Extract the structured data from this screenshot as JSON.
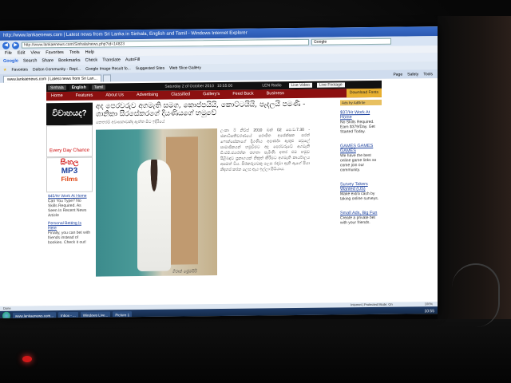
{
  "browser": {
    "title": "http://www.lankaenews.com | Latest news from Sri Lanka in Sinhala, English and Tamil - Windows Internet Explorer",
    "url": "http://www.lankaenews.com/Sinhala/news.php?id=14823",
    "search_engine": "Google",
    "menu": [
      "File",
      "Edit",
      "View",
      "Favorites",
      "Tools",
      "Help"
    ],
    "toolbar": [
      "Google",
      "Search",
      "Share",
      "Bookmarks",
      "Check",
      "Translate",
      "AutoFill"
    ],
    "favorites": [
      "Favorites",
      "Dalton Community - Repl...",
      "Google Image Result fo...",
      "Suggested Sites",
      "Web Slice Gallery"
    ],
    "tab_label": "www.lankaenews.com | Latest news from Sri Lan...",
    "commands": [
      "Page",
      "Safety",
      "Tools"
    ]
  },
  "site": {
    "languages": [
      "Sinhala",
      "English",
      "Tamil"
    ],
    "date": "Saturday 2 of October 2010",
    "time": "10:55:00",
    "top_links": [
      "LEN Radio",
      "Live Video",
      "Live Footage"
    ],
    "nav": [
      "Home",
      "Features",
      "About Us",
      "Advertising",
      "Classified",
      "Gallery's",
      "Feed Back",
      "Business"
    ],
    "download_label": "Download Fonts"
  },
  "left_ads": {
    "black_ad": "විවාහයද?",
    "cartoon_ad": "Every Day Chance",
    "films": [
      "සිංහල",
      "MP3",
      "Films"
    ],
    "text_ads": [
      {
        "title": "$45/Hr Work At Home",
        "body": "Can You Type? No Skills Required. As Seen In Recent News Article"
      },
      {
        "title": "Personal Betting Is Here",
        "body": "Finally, you can bet with friends instead of bookies. Check it out!"
      }
    ]
  },
  "article": {
    "headline": "අද පෙරවරුව අගමැති සමග, කොප්පයියි, කොට්ටයියි, පැදලයි පමණි - ශානිකා සීරසේකරගේ දියණියගේ හමුවේ",
    "subhead": "කෙතරම් අවාසනාවක්ද ඇත්ත මිට ඉදිරියේ",
    "caption": "ශිරාන් ප්‍රේමසිරි",
    "body": "ලංකා ඊ නිව්ස් 2010 ඔක් 02 පෙ.ව.7.30 - ජනාධිපතිවරණයේ පරාජිත අපේක්ෂක සරත් ෆොන්සේකාගේ දියණිය අපර්ණා ඇතුළු පවුලේ සාමාජිකයන් හමුවීමට අද පෙරවරුවේ අගමැති ඩී.එම්.ජයරත්න මහතා පැමිණි අතර එම හමුව පිළිබඳව ප්‍රකාශයක් නිකුත් කිරීමට අගමැති කාර්යාලය අසමත් විය. සිරකරුවෙකු ලෙස රඳවා ඇති ඇගේ පියා නිදහස් කරන ලෙස ඇය ඉල්ලා සිටියාය."
  },
  "right_ads": {
    "choices_label": "Ads by AdBrite",
    "ads": [
      {
        "title": "$37/Hr Work At Home",
        "body": "No Skills Required. Earn $379/Day. Get Started Today."
      },
      {
        "title": "GAMES GAMES GAMES",
        "body": "We have the best online game links so come join our community."
      },
      {
        "title": "Survey Takers Wanted (US)",
        "body": "Make extra cash by taking online surveys."
      },
      {
        "title": "Small Ads, Big Fun",
        "body": "Create a private bet with your friends."
      }
    ]
  },
  "status": {
    "left": "Done",
    "zone": "Internet | Protected Mode: On",
    "zoom": "100%"
  },
  "taskbar": {
    "items": [
      "www.lankaenews.com...",
      "Inbox - ...",
      "Windows Live...",
      "Picture 1"
    ],
    "clock": "10:55"
  }
}
